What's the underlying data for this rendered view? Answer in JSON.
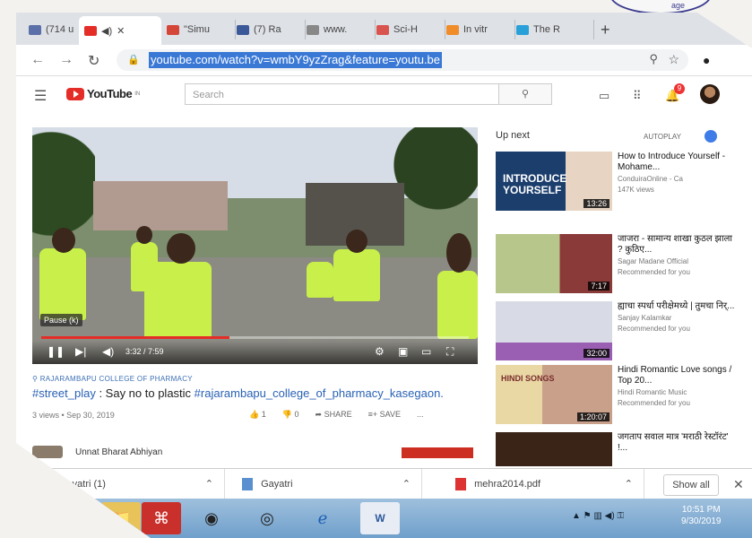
{
  "tabs": [
    {
      "label": "(714 u",
      "color": "#5b6fa8"
    },
    {
      "label": "",
      "color": "#e52d27"
    },
    {
      "label": "\"Simu",
      "color": "#d44638"
    },
    {
      "label": "(7) Ra",
      "color": "#3b5998"
    },
    {
      "label": "www.",
      "color": "#888888"
    },
    {
      "label": "Sci-H",
      "color": "#d9534f"
    },
    {
      "label": "In vitr",
      "color": "#f08c2a"
    },
    {
      "label": "The R",
      "color": "#2aa0d8"
    }
  ],
  "address": {
    "url": "youtube.com/watch?v=wmbY9yzZrag&feature=youtu.be"
  },
  "youtube": {
    "logo": "YouTube",
    "logo_sup": "IN",
    "search_placeholder": "Search",
    "notifications": "9"
  },
  "video": {
    "pause_tip": "Pause (k)",
    "time": "3:32 / 7:59",
    "progress": 0.44,
    "channel_tag": "RAJARAMBAPU COLLEGE OF PHARMACY",
    "title_tag1": "#street_play",
    "title_mid": " : Say no to plastic ",
    "title_tag2": "#rajarambapu_college_of_pharmacy_kasegaon.",
    "meta": "3 views • Sep 30, 2019",
    "likes": "1",
    "dislikes": "0",
    "share": "SHARE",
    "save": "SAVE",
    "more": "...",
    "channel_name": "Unnat Bharat Abhiyan"
  },
  "sidebar": {
    "up_next": "Up next",
    "autoplay": "AUTOPLAY",
    "items": [
      {
        "title": "How to Introduce Yourself - Mohame...",
        "channel": "ConduiraOnline - Ca",
        "meta": "147K views",
        "duration": "13:26",
        "thumb_text": "INTRODUCE YOURSELF"
      },
      {
        "title": "जाजरा - सामान्य शाखा कुठल झाला ? कुठिए...",
        "channel": "Sagar Madane Official",
        "meta": "Recommended for you",
        "duration": "7:17",
        "thumb_text": ""
      },
      {
        "title": "ह्याचा स्पर्धा परीक्षेमध्ये | तुमचा निर्...",
        "channel": "Sanjay Kalamkar",
        "meta": "Recommended for you",
        "duration": "32:00",
        "thumb_text": ""
      },
      {
        "title": "Hindi Romantic Love songs / Top 20...",
        "channel": "Hindi Romantic Music",
        "meta": "Recommended for you",
        "duration": "1:20:07",
        "thumb_text": "HINDI SONGS"
      },
      {
        "title": "जगताप सवाल मात्र 'मराठी रेस्टॉरंट' !...",
        "channel": "",
        "meta": "",
        "duration": "",
        "thumb_text": ""
      }
    ]
  },
  "downloads": {
    "items": [
      {
        "name": "Gayatri (1)"
      },
      {
        "name": "Gayatri"
      },
      {
        "name": "mehra2014.pdf"
      }
    ],
    "show_all": "Show all"
  },
  "taskbar": {
    "time": "10:51 PM",
    "date": "9/30/2019"
  },
  "colors": {
    "accent": "#e52d27",
    "url_highlight": "#3a78d6",
    "toggle": "#3e7ce8"
  }
}
